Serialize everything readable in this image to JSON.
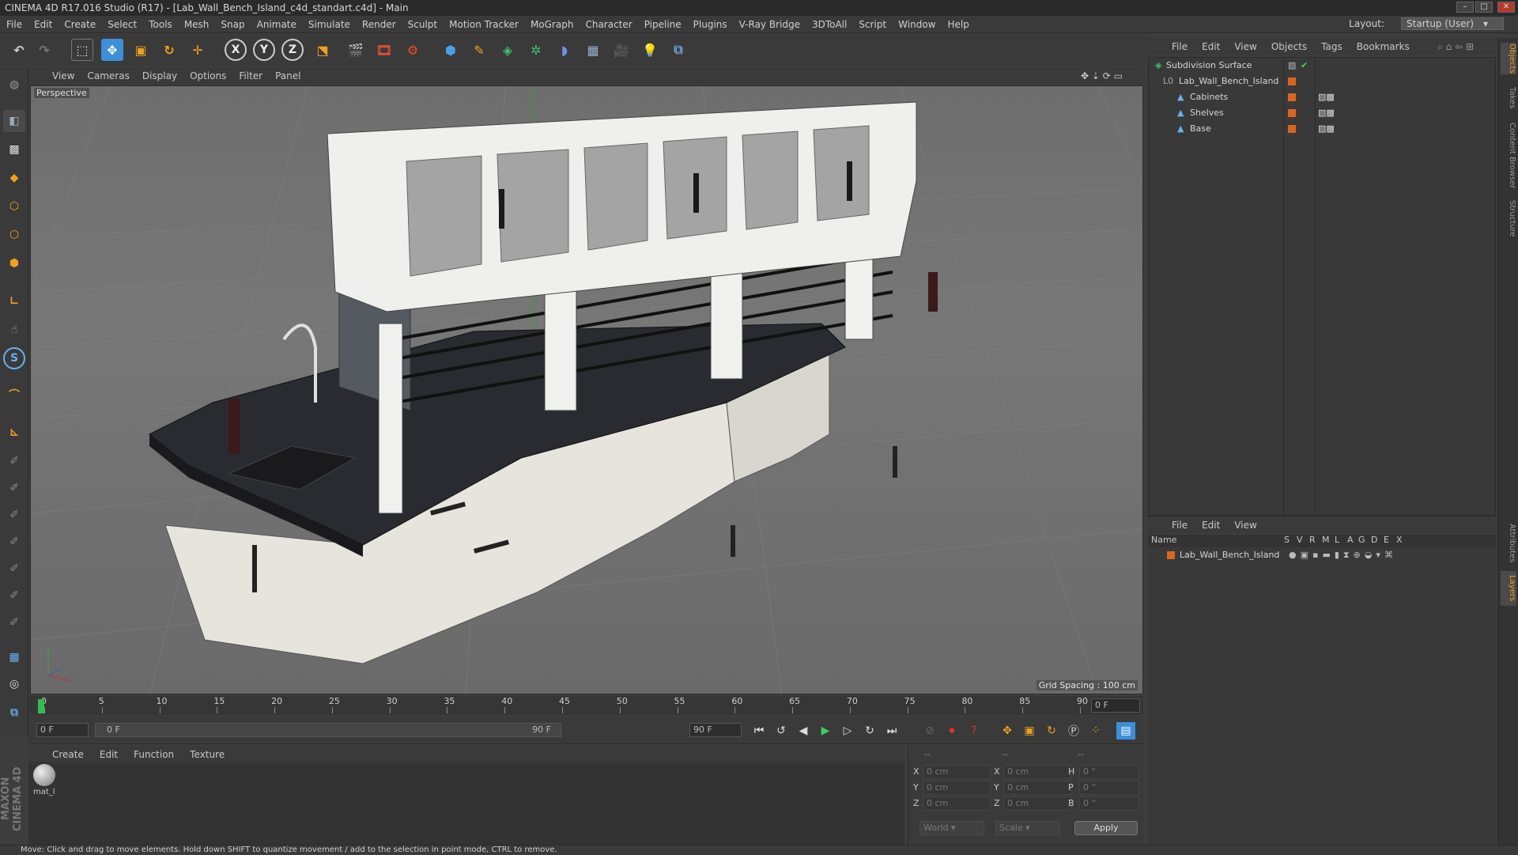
{
  "window": {
    "title": "CINEMA 4D R17.016 Studio (R17) - [Lab_Wall_Bench_Island_c4d_standart.c4d] - Main"
  },
  "menu": [
    "File",
    "Edit",
    "Create",
    "Select",
    "Tools",
    "Mesh",
    "Snap",
    "Animate",
    "Simulate",
    "Render",
    "Sculpt",
    "Motion Tracker",
    "MoGraph",
    "Character",
    "Pipeline",
    "Plugins",
    "V-Ray Bridge",
    "3DToAll",
    "Script",
    "Window",
    "Help"
  ],
  "layout": {
    "label": "Layout:",
    "value": "Startup (User)"
  },
  "toolbar": {
    "x_label": "X",
    "y_label": "Y",
    "z_label": "Z"
  },
  "viewport": {
    "menu": [
      "View",
      "Cameras",
      "Display",
      "Options",
      "Filter",
      "Panel"
    ],
    "label": "Perspective",
    "grid_spacing": "Grid Spacing : 100 cm"
  },
  "timeline": {
    "ticks": [
      "0",
      "5",
      "10",
      "15",
      "20",
      "25",
      "30",
      "35",
      "40",
      "45",
      "50",
      "55",
      "60",
      "65",
      "70",
      "75",
      "80",
      "85",
      "90"
    ],
    "current_frame": "0 F",
    "start_field": "0 F",
    "range_start": "0 F",
    "range_end": "90 F",
    "end_field": "90 F"
  },
  "material_manager": {
    "menu": [
      "Create",
      "Edit",
      "Function",
      "Texture"
    ],
    "materials": [
      {
        "name": "mat_l"
      }
    ]
  },
  "coords": {
    "headers": [
      "--",
      "--",
      "--"
    ],
    "rows": [
      {
        "a": "X",
        "av": "0 cm",
        "b": "X",
        "bv": "0 cm",
        "c": "H",
        "cv": "0 °"
      },
      {
        "a": "Y",
        "av": "0 cm",
        "b": "Y",
        "bv": "0 cm",
        "c": "P",
        "cv": "0 °"
      },
      {
        "a": "Z",
        "av": "0 cm",
        "b": "Z",
        "bv": "0 cm",
        "c": "B",
        "cv": "0 °"
      }
    ],
    "mode": "World",
    "scale": "Scale",
    "apply": "Apply"
  },
  "object_manager": {
    "menu": [
      "File",
      "Edit",
      "View",
      "Objects",
      "Tags",
      "Bookmarks"
    ],
    "objects": [
      {
        "name": "Subdivision Surface",
        "indent": 0
      },
      {
        "name": "Lab_Wall_Bench_Island",
        "indent": 1
      },
      {
        "name": "Cabinets",
        "indent": 2
      },
      {
        "name": "Shelves",
        "indent": 2
      },
      {
        "name": "Base",
        "indent": 2
      }
    ]
  },
  "layer_manager": {
    "menu": [
      "File",
      "Edit",
      "View"
    ],
    "columns": [
      "Name",
      "S",
      "V",
      "R",
      "M",
      "L",
      "A",
      "G",
      "D",
      "E",
      "X"
    ],
    "layers": [
      {
        "name": "Lab_Wall_Bench_Island",
        "color": "#d9661f"
      }
    ]
  },
  "right_tabs": [
    "Objects",
    "Takes",
    "Content Browser",
    "Structure",
    "Attributes",
    "Layers"
  ],
  "status": "Move: Click and drag to move elements. Hold down SHIFT to quantize movement / add to the selection in point mode, CTRL to remove.",
  "brand": "MAXON CINEMA 4D",
  "colors": {
    "accent": "#3c8fd8",
    "object_orange": "#d9661f",
    "counter": "#e8e8e8"
  }
}
